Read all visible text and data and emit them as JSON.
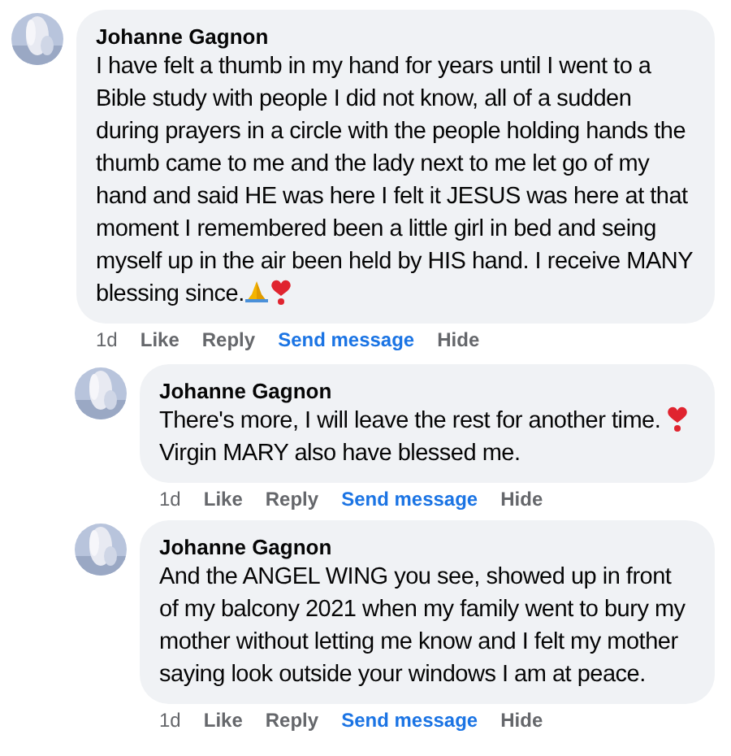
{
  "comments": [
    {
      "author": "Johanne Gagnon",
      "body": [
        {
          "kind": "text",
          "text": "I have felt a thumb in my hand for years until I went to a Bible study with people I did not know, all of a sudden during prayers in a circle with the people holding hands the thumb came to me and the lady next to me let go of my hand and said HE was here I felt it JESUS was here at that moment I remembered been a little girl in bed and seing myself up in the air been held by HIS hand. I receive MANY blessing since."
        },
        {
          "kind": "pray"
        },
        {
          "kind": "heart"
        }
      ],
      "time": "1d",
      "actions": [
        "Like",
        "Reply",
        "Send message",
        "Hide"
      ],
      "replies": [
        {
          "author": "Johanne Gagnon",
          "body": [
            {
              "kind": "text",
              "text": "There's more, I will leave the rest for another time. "
            },
            {
              "kind": "heart"
            },
            {
              "kind": "text",
              "text": " Virgin MARY also have blessed me."
            }
          ],
          "time": "1d",
          "actions": [
            "Like",
            "Reply",
            "Send message",
            "Hide"
          ]
        },
        {
          "author": "Johanne Gagnon",
          "body": [
            {
              "kind": "text",
              "text": "And the ANGEL WING you see, showed up in front of my balcony 2021 when my family went to bury my mother without letting me know and I felt my mother saying look outside your windows I am at peace."
            }
          ],
          "time": "1d",
          "actions": [
            "Like",
            "Reply",
            "Send message",
            "Hide"
          ]
        }
      ]
    }
  ]
}
